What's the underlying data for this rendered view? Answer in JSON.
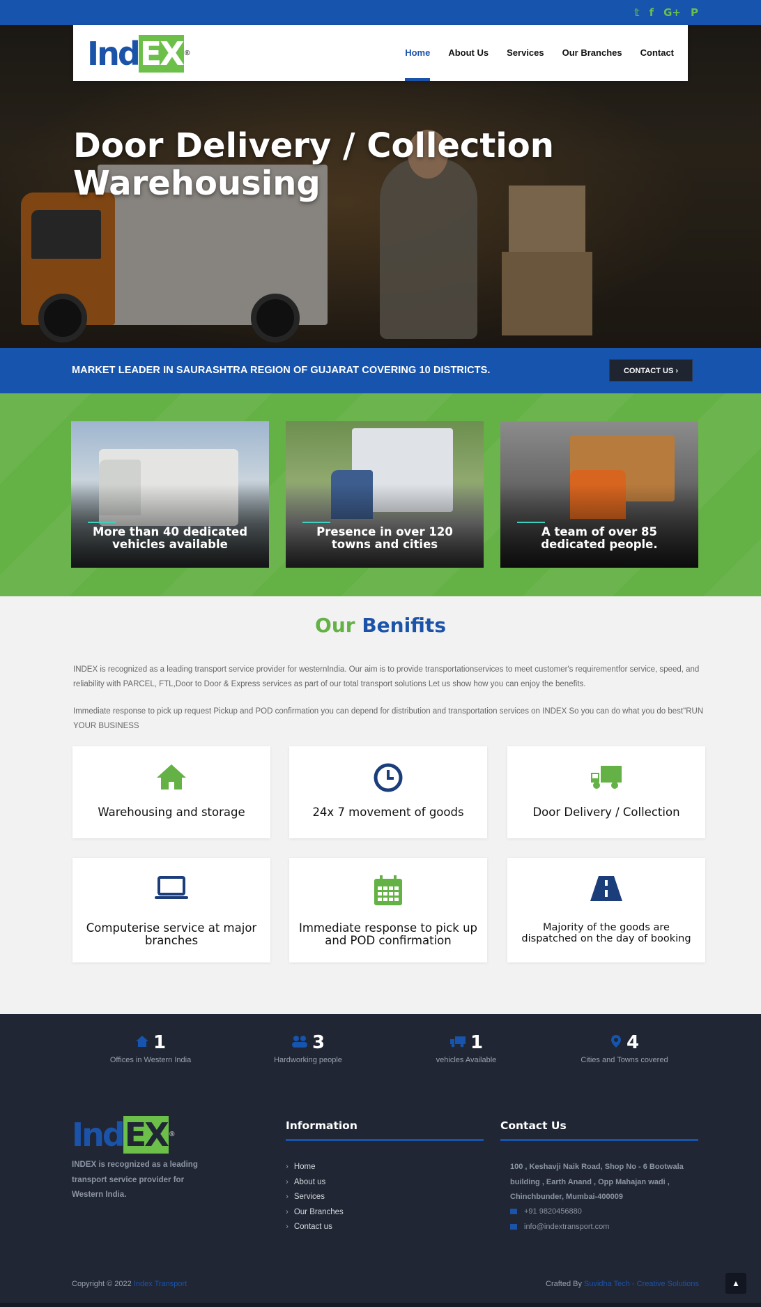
{
  "social": {
    "icons": [
      "twitter-icon",
      "facebook-icon",
      "google-plus-icon",
      "pinterest-icon"
    ],
    "glyphs": [
      "𝕥",
      "f",
      "G+",
      "P"
    ]
  },
  "brand": {
    "logo_ind": "Ind",
    "logo_ex": "EX",
    "logo_reg": "®",
    "color_blue": "#1654ad",
    "color_green": "#64b145"
  },
  "nav": {
    "items": [
      {
        "label": "Home",
        "active": true
      },
      {
        "label": "About Us"
      },
      {
        "label": "Services"
      },
      {
        "label": "Our Branches"
      },
      {
        "label": "Contact"
      }
    ]
  },
  "hero": {
    "title_line1": "Door Delivery / Collection",
    "title_line2": "Warehousing"
  },
  "banner": {
    "text": "MARKET LEADER IN SAURASHTRA REGION OF GUJARAT COVERING 10 DISTRICTS.",
    "button": "CONTACT US ›"
  },
  "feature_cards": [
    {
      "caption": "More than 40 dedicated vehicles available"
    },
    {
      "caption": "Presence in over 120 towns and cities"
    },
    {
      "caption": "A team of over 85 dedicated people."
    }
  ],
  "benefits": {
    "title_a": "Our",
    "title_b": "Benifits",
    "para1": "INDEX is recognized as a leading transport service provider for westernIndia. Our aim is to provide transportationservices to meet customer's requirementfor service, speed, and reliability with PARCEL, FTL,Door to Door & Express services as part of our total transport solutions Let us show how you can enjoy the benefits.",
    "para2": "Immediate response to pick up request Pickup and POD confirmation you can depend for distribution and transportation services on INDEX So you can do what you do best\"RUN YOUR BUSINESS",
    "items": [
      {
        "label": "Warehousing and storage",
        "icon": "home-icon"
      },
      {
        "label": "24x 7 movement of goods",
        "icon": "clock-icon"
      },
      {
        "label": "Door Delivery / Collection",
        "icon": "truck-icon"
      },
      {
        "label": "Computerise service at major branches",
        "icon": "laptop-icon"
      },
      {
        "label": "Immediate response to pick up and POD confirmation",
        "icon": "calendar-icon"
      },
      {
        "label": "Majority of the goods are dispatched on the day of booking",
        "icon": "road-icon"
      }
    ]
  },
  "stats": [
    {
      "num": "1",
      "caption": "Offices in Western India",
      "icon": "home-icon"
    },
    {
      "num": "3",
      "caption": "Hardworking people",
      "icon": "users-icon"
    },
    {
      "num": "1",
      "caption": "vehicles Available",
      "icon": "truck-icon"
    },
    {
      "num": "4",
      "caption": "Cities and Towns covered",
      "icon": "map-pin-icon"
    }
  ],
  "footer": {
    "desc": "INDEX is recognized as a leading transport service provider for Western India.",
    "info_title": "Information",
    "links": [
      "Home",
      "About us",
      "Services",
      "Our Branches",
      "Contact us"
    ],
    "contact_title": "Contact Us",
    "address": "100 , Keshavji Naik Road, Shop No - 6 Bootwala building , Earth Anand , Opp Mahajan wadi , Chinchbunder, Mumbai-400009",
    "phone": "+91 9820456880",
    "email": "info@indextransport.com",
    "copyright": "Copyright © 2022",
    "copyright_link": "Index Transport",
    "crafted_by": "Crafted By",
    "crafted_link": "Suvidha Tech - Creative Solutions",
    "to_top": "▲"
  }
}
